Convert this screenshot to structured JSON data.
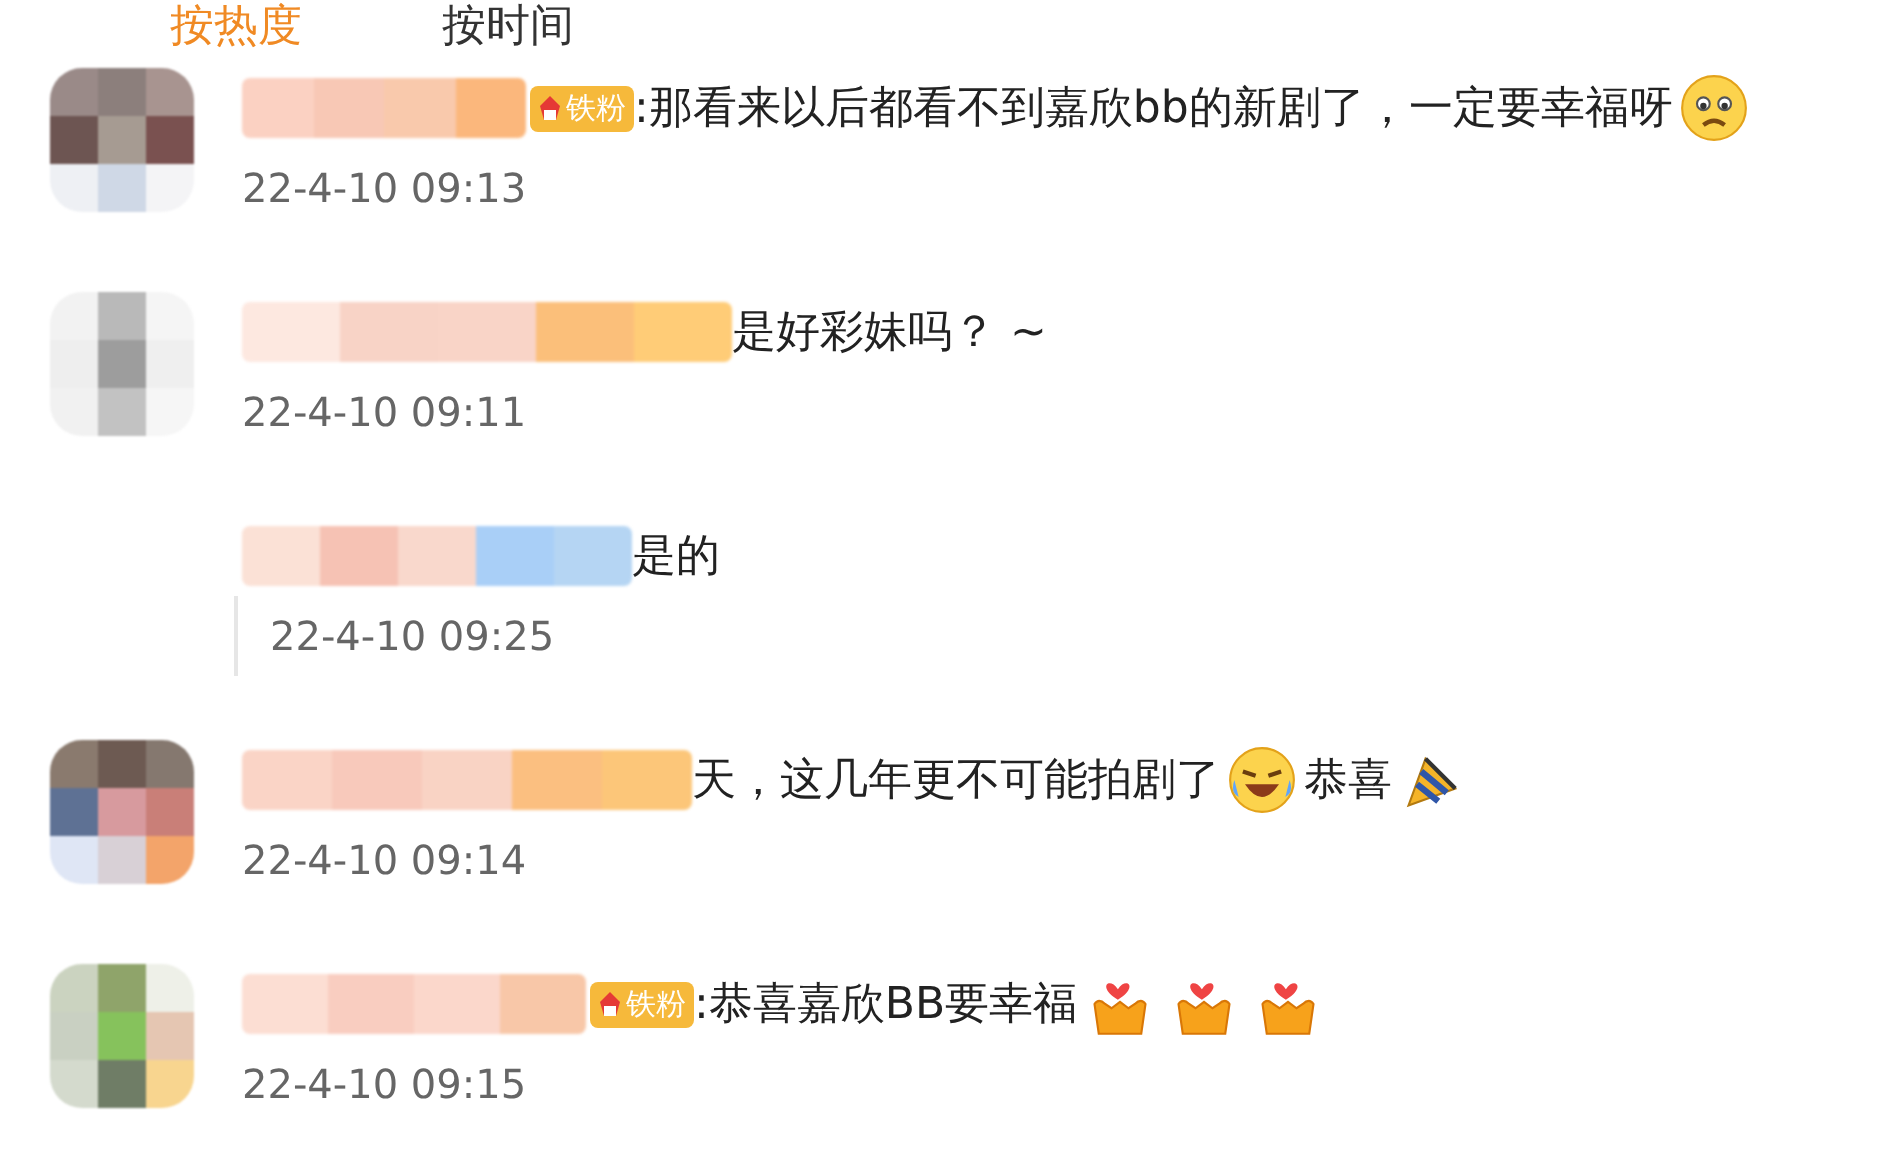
{
  "tabs": [
    {
      "label": "按热度",
      "selected": true
    },
    {
      "label": "按时间",
      "selected": false
    }
  ],
  "comments": [
    {
      "kind": "comment",
      "badge": "铁粉",
      "parts": [
        {
          "kind": "text",
          "text": ":那看来以后都看不到嘉欣bb的新剧了，一定要幸福呀"
        },
        {
          "kind": "sad-face"
        }
      ],
      "time": "22-4-10 09:13"
    },
    {
      "kind": "comment",
      "parts": [
        {
          "kind": "text",
          "text": "是好彩妹吗？ ~"
        }
      ],
      "time": "22-4-10 09:11"
    },
    {
      "kind": "reply",
      "parts": [
        {
          "kind": "text",
          "text": "是的"
        }
      ],
      "time": "22-4-10 09:25"
    },
    {
      "kind": "comment",
      "parts": [
        {
          "kind": "text",
          "text": "天，这几年更不可能拍剧了"
        },
        {
          "kind": "laughing-face"
        },
        {
          "kind": "text",
          "text": "恭喜"
        },
        {
          "kind": "party-popper"
        }
      ],
      "time": "22-4-10 09:14"
    },
    {
      "kind": "comment",
      "badge": "铁粉",
      "parts": [
        {
          "kind": "text",
          "text": ":恭喜嘉欣BB要幸福"
        },
        {
          "kind": "heart-hands"
        },
        {
          "kind": "heart-hands"
        },
        {
          "kind": "heart-hands"
        }
      ],
      "time": "22-4-10 09:15"
    }
  ]
}
